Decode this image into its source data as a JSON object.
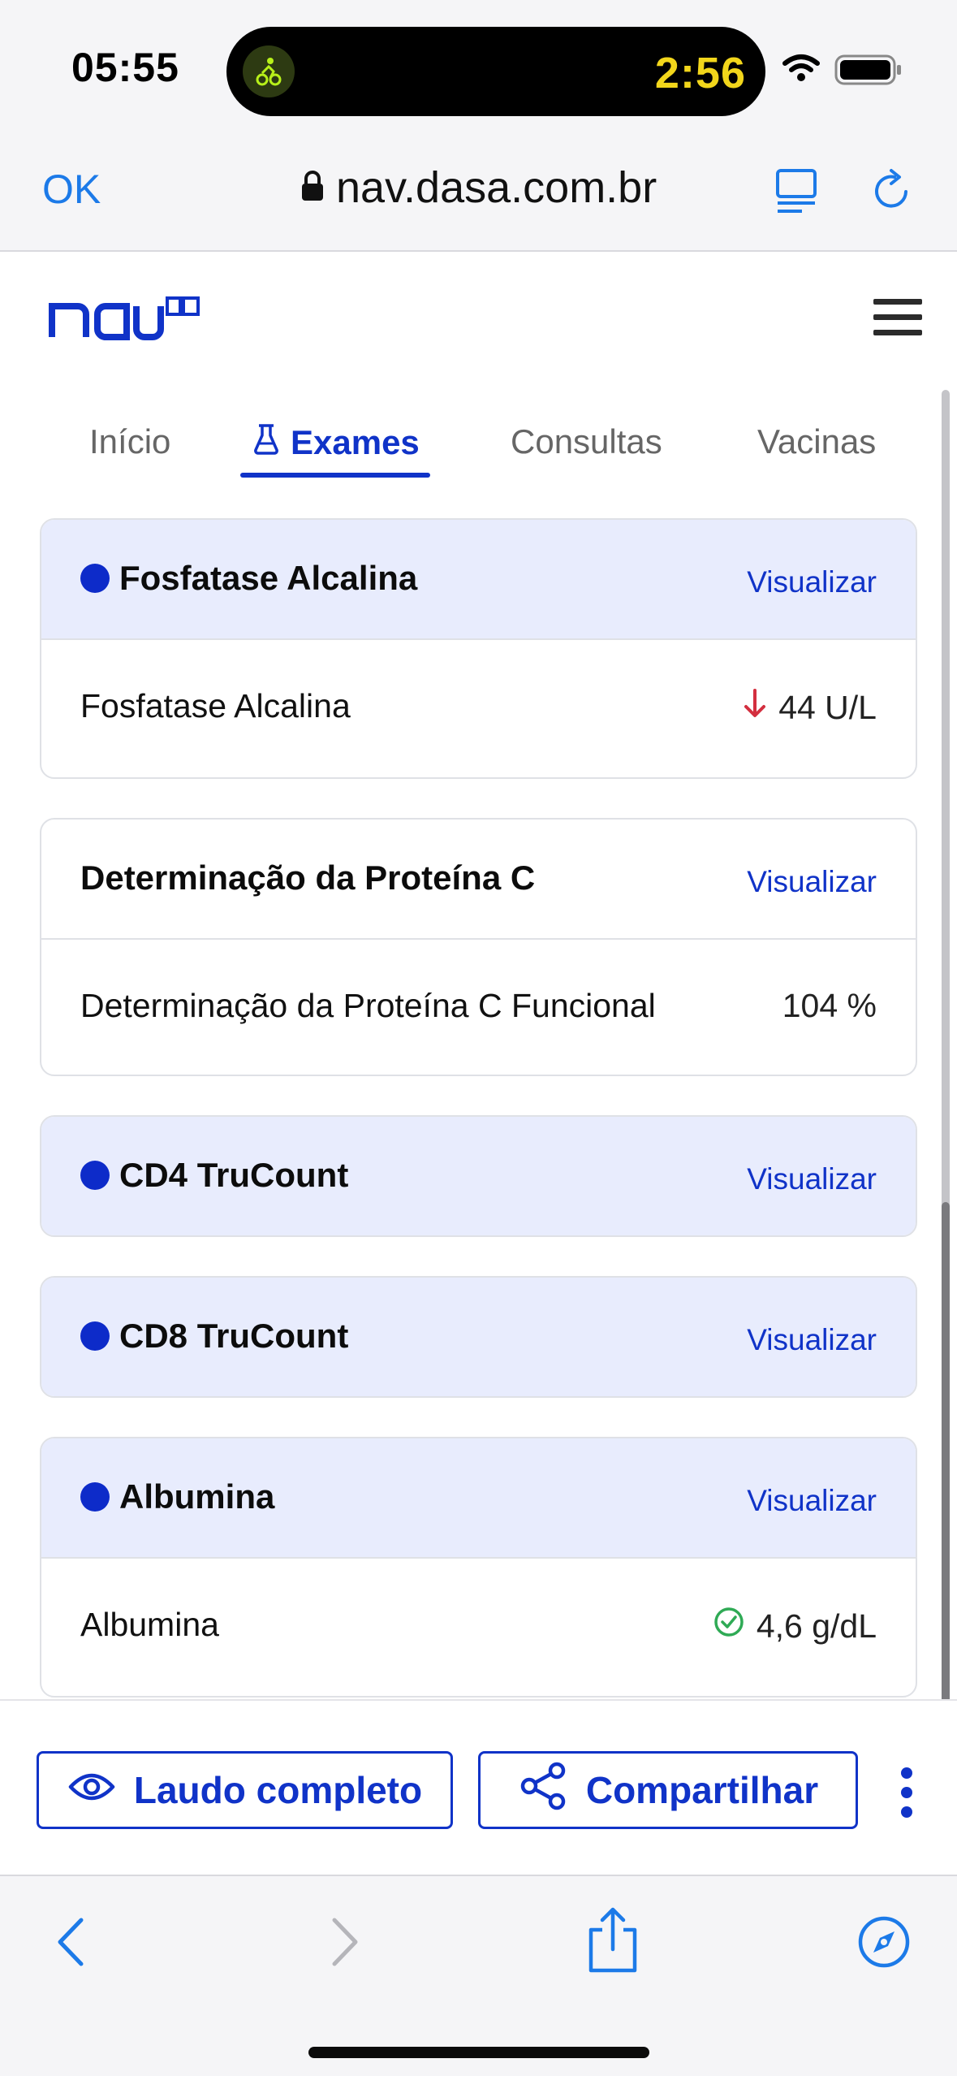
{
  "status_bar": {
    "time": "05:55",
    "live_activity_timer": "2:56",
    "live_activity_icon": "cycling-icon",
    "signal_icon": "wifi-icon",
    "battery_icon": "battery-icon"
  },
  "browser": {
    "done_label": "OK",
    "url": "nav.dasa.com.br",
    "lock_icon": "lock-icon",
    "reader_icon": "reader-mode-icon",
    "reload_icon": "reload-icon"
  },
  "site": {
    "logo_text": "nav",
    "menu_icon": "hamburger-menu-icon"
  },
  "tabs": [
    {
      "label": "Início",
      "active": false
    },
    {
      "label": "Exames",
      "active": true,
      "icon": "flask-icon"
    },
    {
      "label": "Consultas",
      "active": false
    },
    {
      "label": "Vacinas",
      "active": false
    }
  ],
  "exams": [
    {
      "title": "Fosfatase Alcalina",
      "new_indicator": true,
      "action": "Visualizar",
      "results": [
        {
          "label": "Fosfatase Alcalina",
          "value": "44 U/L",
          "status_icon": "arrow-down-icon",
          "status_color": "#d32f3f"
        }
      ]
    },
    {
      "title": "Determinação da Proteína C",
      "new_indicator": false,
      "action": "Visualizar",
      "results": [
        {
          "label": "Determinação da Proteína C Funcional",
          "value": "104 %"
        }
      ]
    },
    {
      "title": "CD4 TruCount",
      "new_indicator": true,
      "action": "Visualizar",
      "results": []
    },
    {
      "title": "CD8 TruCount",
      "new_indicator": true,
      "action": "Visualizar",
      "results": []
    },
    {
      "title": "Albumina",
      "new_indicator": true,
      "action": "Visualizar",
      "results": [
        {
          "label": "Albumina",
          "value": "4,6 g/dL",
          "status_icon": "check-circle-icon",
          "status_color": "#2faa55"
        }
      ]
    }
  ],
  "actions": {
    "full_report_label": "Laudo completo",
    "full_report_icon": "eye-icon",
    "share_label": "Compartilhar",
    "share_icon": "share-icon",
    "more_icon": "more-vertical-icon"
  },
  "toolbar": {
    "back_icon": "back-icon",
    "forward_icon": "forward-icon",
    "share_icon": "share-sheet-icon",
    "compass_icon": "compass-icon"
  },
  "colors": {
    "brand_blue": "#1033c8",
    "highlight_bg": "#e8ecfd",
    "ios_link": "#1c7ae8"
  }
}
